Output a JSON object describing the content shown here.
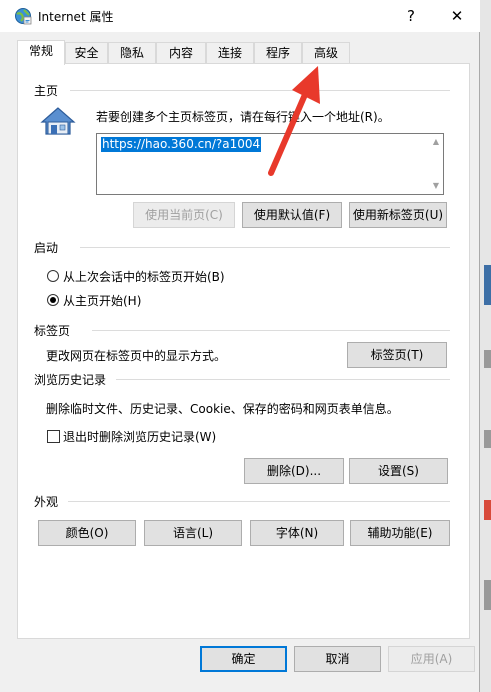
{
  "window": {
    "title": "Internet 属性",
    "help_label": "?",
    "close_label": "✕"
  },
  "tabs": [
    "常规",
    "安全",
    "隐私",
    "内容",
    "连接",
    "程序",
    "高级"
  ],
  "homepage": {
    "section": "主页",
    "description": "若要创建多个主页标签页，请在每行键入一个地址(R)。",
    "url": "https://hao.360.cn/?a1004",
    "use_current": "使用当前页(C)",
    "use_default": "使用默认值(F)",
    "use_new_tab": "使用新标签页(U)"
  },
  "startup": {
    "section": "启动",
    "option_last_session": "从上次会话中的标签页开始(B)",
    "option_home": "从主页开始(H)",
    "selected": "option_home"
  },
  "tabs_section": {
    "section": "标签页",
    "description": "更改网页在标签页中的显示方式。",
    "button": "标签页(T)"
  },
  "history": {
    "section": "浏览历史记录",
    "description": "删除临时文件、历史记录、Cookie、保存的密码和网页表单信息。",
    "checkbox_label": "退出时删除浏览历史记录(W)",
    "checked": false,
    "delete_button": "删除(D)...",
    "settings_button": "设置(S)"
  },
  "appearance": {
    "section": "外观",
    "colors": "颜色(O)",
    "languages": "语言(L)",
    "fonts": "字体(N)",
    "accessibility": "辅助功能(E)"
  },
  "footer": {
    "ok": "确定",
    "cancel": "取消",
    "apply": "应用(A)"
  },
  "colors": {
    "accent": "#0078d7",
    "annotation_arrow": "#e8392b"
  }
}
